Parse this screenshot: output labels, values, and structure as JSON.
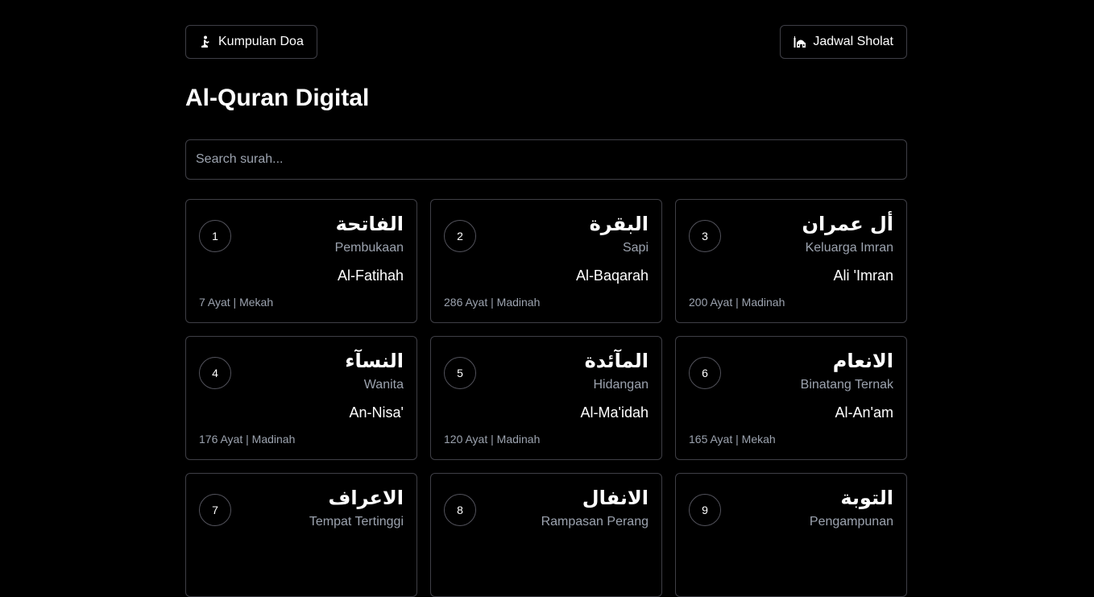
{
  "nav": {
    "left_button": {
      "label": "Kumpulan Doa",
      "icon": "person-praying-icon"
    },
    "right_button": {
      "label": "Jadwal Sholat",
      "icon": "mosque-icon"
    }
  },
  "page": {
    "title": "Al-Quran Digital"
  },
  "search": {
    "placeholder": "Search surah...",
    "value": ""
  },
  "surahs": [
    {
      "number": "1",
      "arabic": "الفاتحة",
      "meaning": "Pembukaan",
      "latin": "Al-Fatihah",
      "info": "7 Ayat | Mekah"
    },
    {
      "number": "2",
      "arabic": "البقرة",
      "meaning": "Sapi",
      "latin": "Al-Baqarah",
      "info": "286 Ayat | Madinah"
    },
    {
      "number": "3",
      "arabic": "أل عمران",
      "meaning": "Keluarga Imran",
      "latin": "Ali 'Imran",
      "info": "200 Ayat | Madinah"
    },
    {
      "number": "4",
      "arabic": "النسآء",
      "meaning": "Wanita",
      "latin": "An-Nisa'",
      "info": "176 Ayat | Madinah"
    },
    {
      "number": "5",
      "arabic": "المآئدة",
      "meaning": "Hidangan",
      "latin": "Al-Ma'idah",
      "info": "120 Ayat | Madinah"
    },
    {
      "number": "6",
      "arabic": "الانعام",
      "meaning": "Binatang Ternak",
      "latin": "Al-An'am",
      "info": "165 Ayat | Mekah"
    },
    {
      "number": "7",
      "arabic": "الاعراف",
      "meaning": "Tempat Tertinggi",
      "latin": "",
      "info": ""
    },
    {
      "number": "8",
      "arabic": "الانفال",
      "meaning": "Rampasan Perang",
      "latin": "",
      "info": ""
    },
    {
      "number": "9",
      "arabic": "التوبة",
      "meaning": "Pengampunan",
      "latin": "",
      "info": ""
    }
  ]
}
